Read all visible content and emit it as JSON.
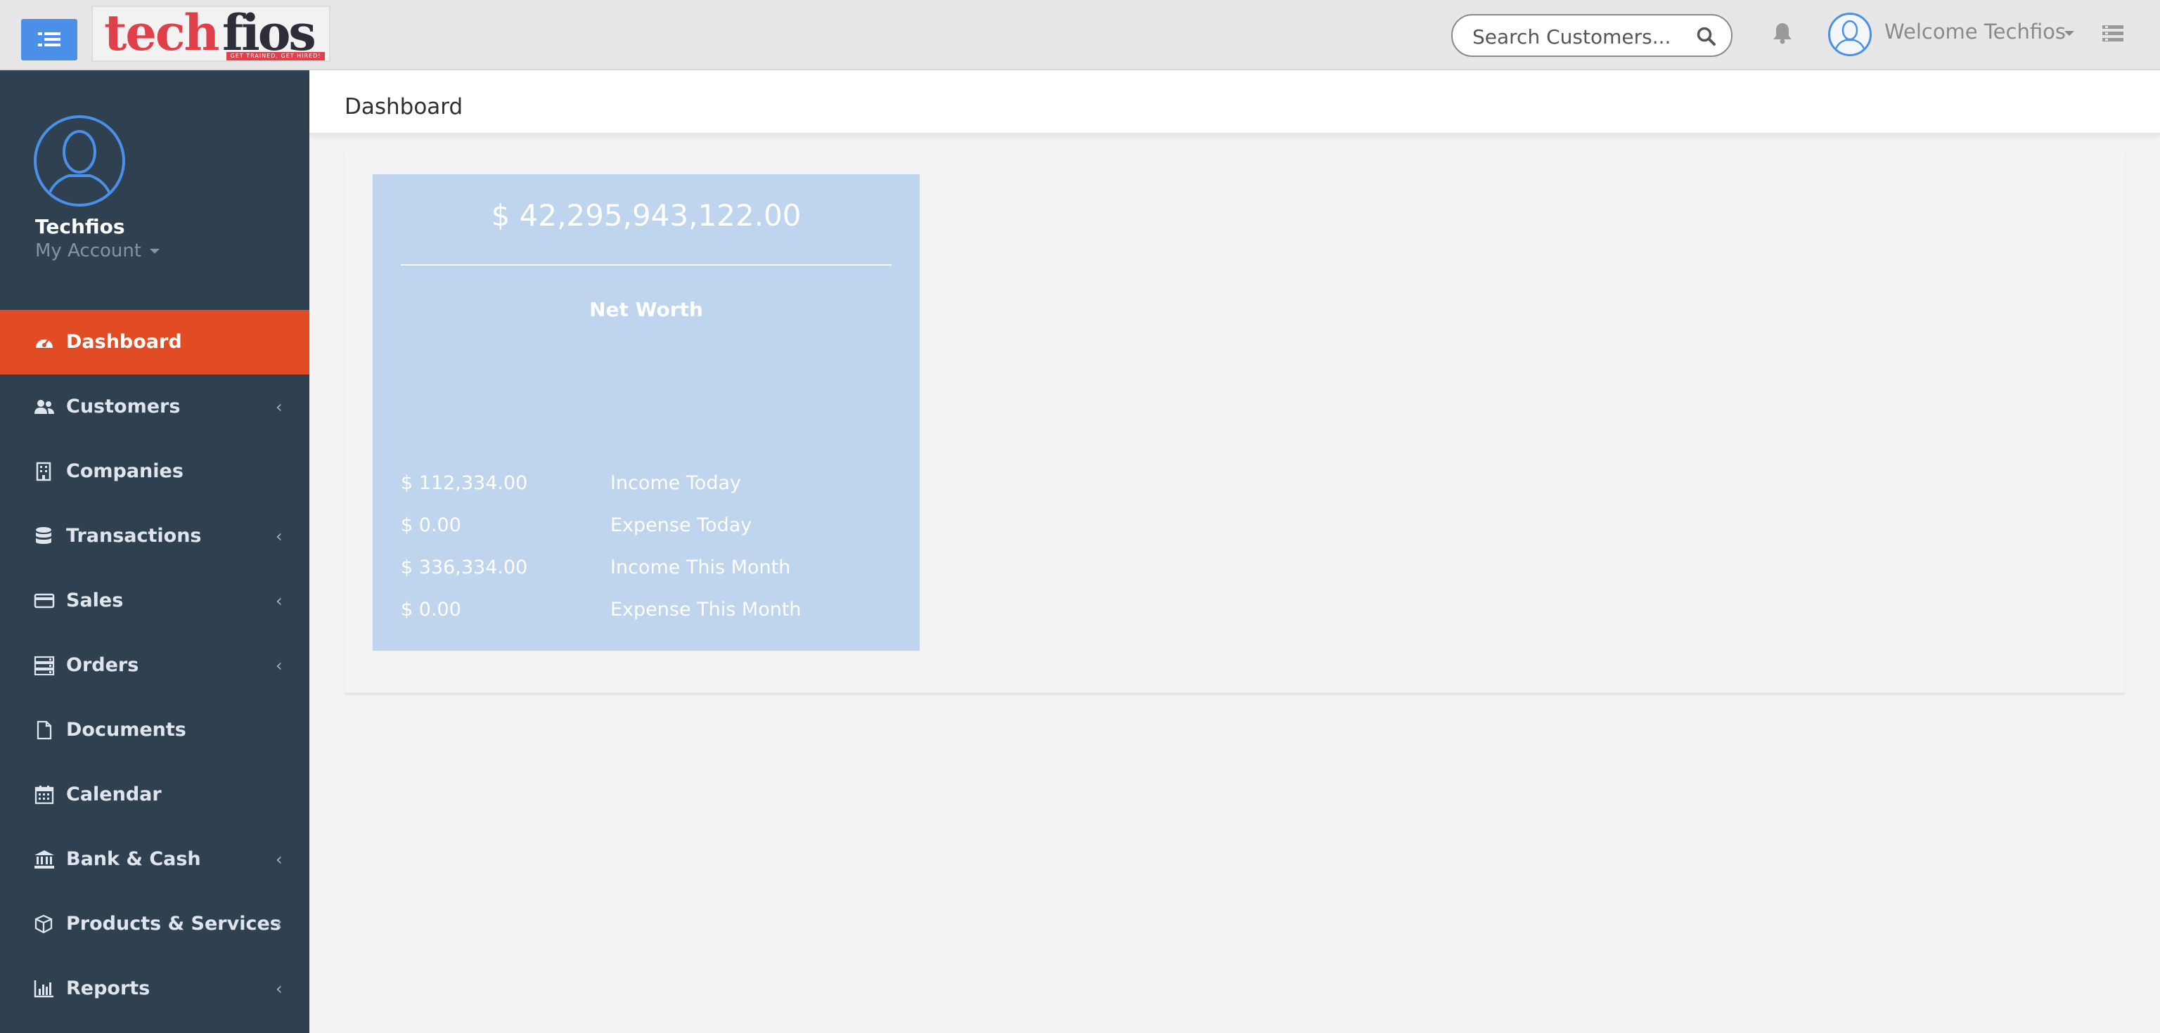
{
  "brand": {
    "logo_text_a": "tech",
    "logo_text_b": "fios",
    "tagline": "GET TRAINED, GET HIRED!"
  },
  "topbar": {
    "search_placeholder": "Search Customers...",
    "welcome_text": "Welcome Techfios"
  },
  "profile": {
    "name": "Techfios",
    "account_label": "My Account"
  },
  "sidebar": {
    "items": [
      {
        "label": "Dashboard",
        "icon": "dashboard-icon",
        "active": true,
        "has_submenu": false
      },
      {
        "label": "Customers",
        "icon": "users-icon",
        "active": false,
        "has_submenu": true
      },
      {
        "label": "Companies",
        "icon": "building-icon",
        "active": false,
        "has_submenu": false
      },
      {
        "label": "Transactions",
        "icon": "database-icon",
        "active": false,
        "has_submenu": true
      },
      {
        "label": "Sales",
        "icon": "credit-card-icon",
        "active": false,
        "has_submenu": true
      },
      {
        "label": "Orders",
        "icon": "server-icon",
        "active": false,
        "has_submenu": true
      },
      {
        "label": "Documents",
        "icon": "file-icon",
        "active": false,
        "has_submenu": false
      },
      {
        "label": "Calendar",
        "icon": "calendar-icon",
        "active": false,
        "has_submenu": false
      },
      {
        "label": "Bank & Cash",
        "icon": "bank-icon",
        "active": false,
        "has_submenu": true
      },
      {
        "label": "Products & Services",
        "icon": "cube-icon",
        "active": false,
        "has_submenu": true
      },
      {
        "label": "Reports",
        "icon": "bar-chart-icon",
        "active": false,
        "has_submenu": true
      }
    ]
  },
  "page": {
    "title": "Dashboard"
  },
  "net_worth": {
    "amount": "$ 42,295,943,122.00",
    "label": "Net Worth",
    "rows": [
      {
        "value": "$ 112,334.00",
        "label": "Income Today"
      },
      {
        "value": "$ 0.00",
        "label": "Expense Today"
      },
      {
        "value": "$ 336,334.00",
        "label": "Income This Month"
      },
      {
        "value": "$ 0.00",
        "label": "Expense This Month"
      }
    ]
  },
  "colors": {
    "sidebar_bg": "#2f4050",
    "active_item": "#e14c24",
    "accent_blue": "#4b8fe8",
    "networth_bg": "#bfd4ed"
  }
}
